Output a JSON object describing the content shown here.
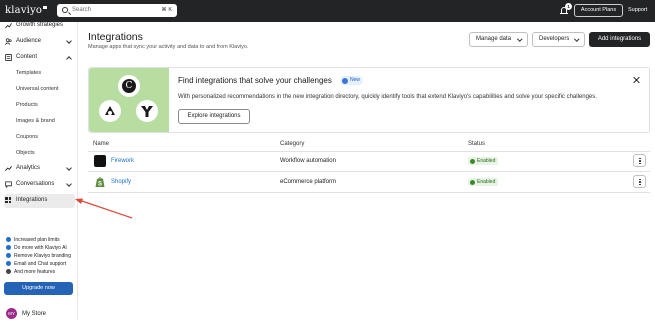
{
  "topbar": {
    "logo": "klaviyo",
    "search_placeholder": "Search",
    "search_shortcut": "⌘ K",
    "notification_count": "1",
    "account_plans": "Account Plans",
    "support": "Support"
  },
  "sidebar": {
    "items": [
      {
        "label": "Growth strategies",
        "icon": "trend-icon"
      },
      {
        "label": "Audience",
        "icon": "users-icon"
      },
      {
        "label": "Content",
        "icon": "content-icon"
      },
      {
        "label": "Analytics",
        "icon": "chart-icon"
      },
      {
        "label": "Conversations",
        "icon": "chat-icon"
      },
      {
        "label": "Integrations",
        "icon": "grid-icon"
      }
    ],
    "content_subitems": [
      "Templates",
      "Universal content",
      "Products",
      "Images & brand",
      "Coupons",
      "Objects"
    ],
    "upsell": [
      "Increased plan limits",
      "Do more with Klaviyo AI",
      "Remove Klaviyo branding",
      "Email and Chat support",
      "And more features"
    ],
    "upgrade_button": "Upgrade now",
    "store_initials": "MY",
    "store_name": "My Store"
  },
  "header": {
    "title": "Integrations",
    "subtitle": "Manage apps that sync your activity and data to and from Klaviyo.",
    "manage_data": "Manage data",
    "developers": "Developers",
    "add_integrations": "Add integrations"
  },
  "banner": {
    "title": "Find integrations that solve your challenges",
    "badge": "New",
    "description": "With personalized recommendations in the new integration directory, quickly identify tools that extend Klaviyo's capabilities and solve your specific challenges.",
    "button": "Explore integrations"
  },
  "table": {
    "columns": [
      "Name",
      "Category",
      "Status"
    ],
    "rows": [
      {
        "name": "Firework",
        "category": "Workflow automation",
        "status": "Enabled"
      },
      {
        "name": "Shopify",
        "category": "eCommerce platform",
        "status": "Enabled"
      }
    ]
  },
  "colors": {
    "topbar": "#232426",
    "link": "#1f6fd1",
    "enabled": "#3a8a2a",
    "banner_art": "#b8dda1",
    "annotation_arrow": "#e0473b"
  }
}
